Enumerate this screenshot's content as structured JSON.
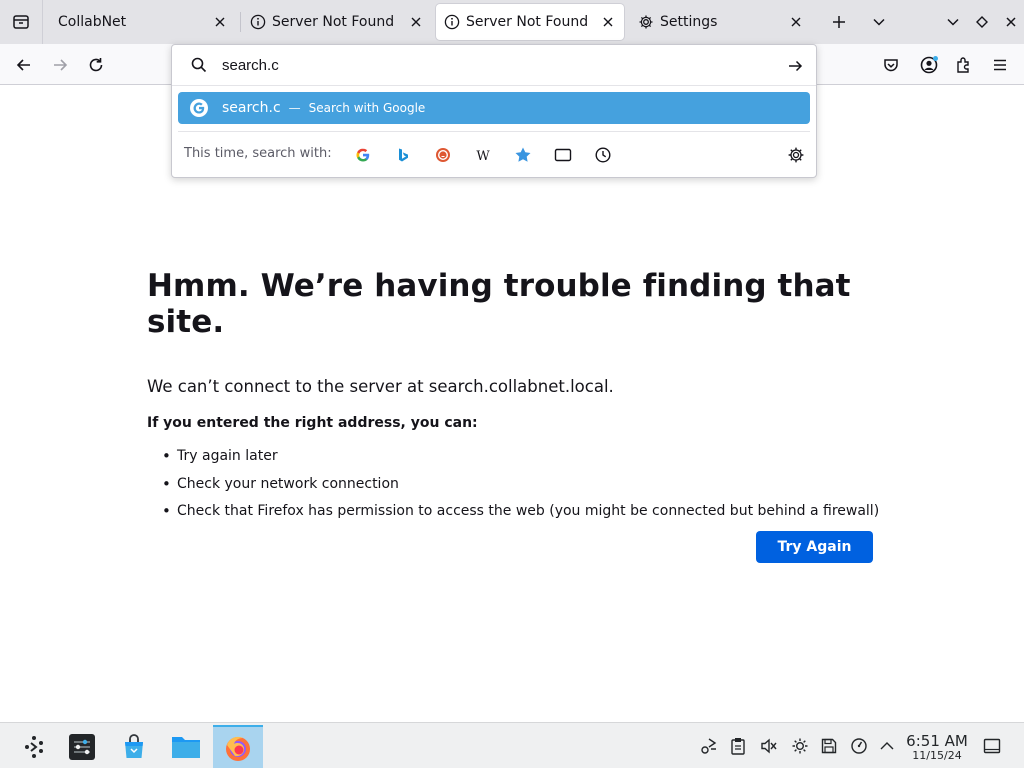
{
  "tabs": [
    {
      "title": "CollabNet",
      "active": false
    },
    {
      "title": "Server Not Found",
      "active": false
    },
    {
      "title": "Server Not Found",
      "active": true
    },
    {
      "title": "Settings",
      "active": false
    }
  ],
  "urlbar": {
    "value": "search.c",
    "suggestion": {
      "text": "search.c",
      "separator": "—",
      "action": "Search with Google"
    },
    "oneoff_label": "This time, search with:",
    "oneoff_engines": [
      "google-icon",
      "bing-icon",
      "duckduckgo-icon",
      "wikipedia-icon",
      "bookmarks-icon",
      "tabs-icon",
      "history-icon"
    ]
  },
  "error": {
    "title": "Hmm. We’re having trouble finding that site.",
    "description": "We can’t connect to the server at search.collabnet.local.",
    "subtitle": "If you entered the right address, you can:",
    "items": [
      "Try again later",
      "Check your network connection",
      "Check that Firefox has permission to access the web (you might be connected but behind a firewall)"
    ],
    "button": "Try Again"
  },
  "clock": {
    "time": "6:51 AM",
    "date": "11/15/24"
  },
  "colors": {
    "accent": "#0061e0",
    "suggestion_highlight": "#45a1de"
  }
}
